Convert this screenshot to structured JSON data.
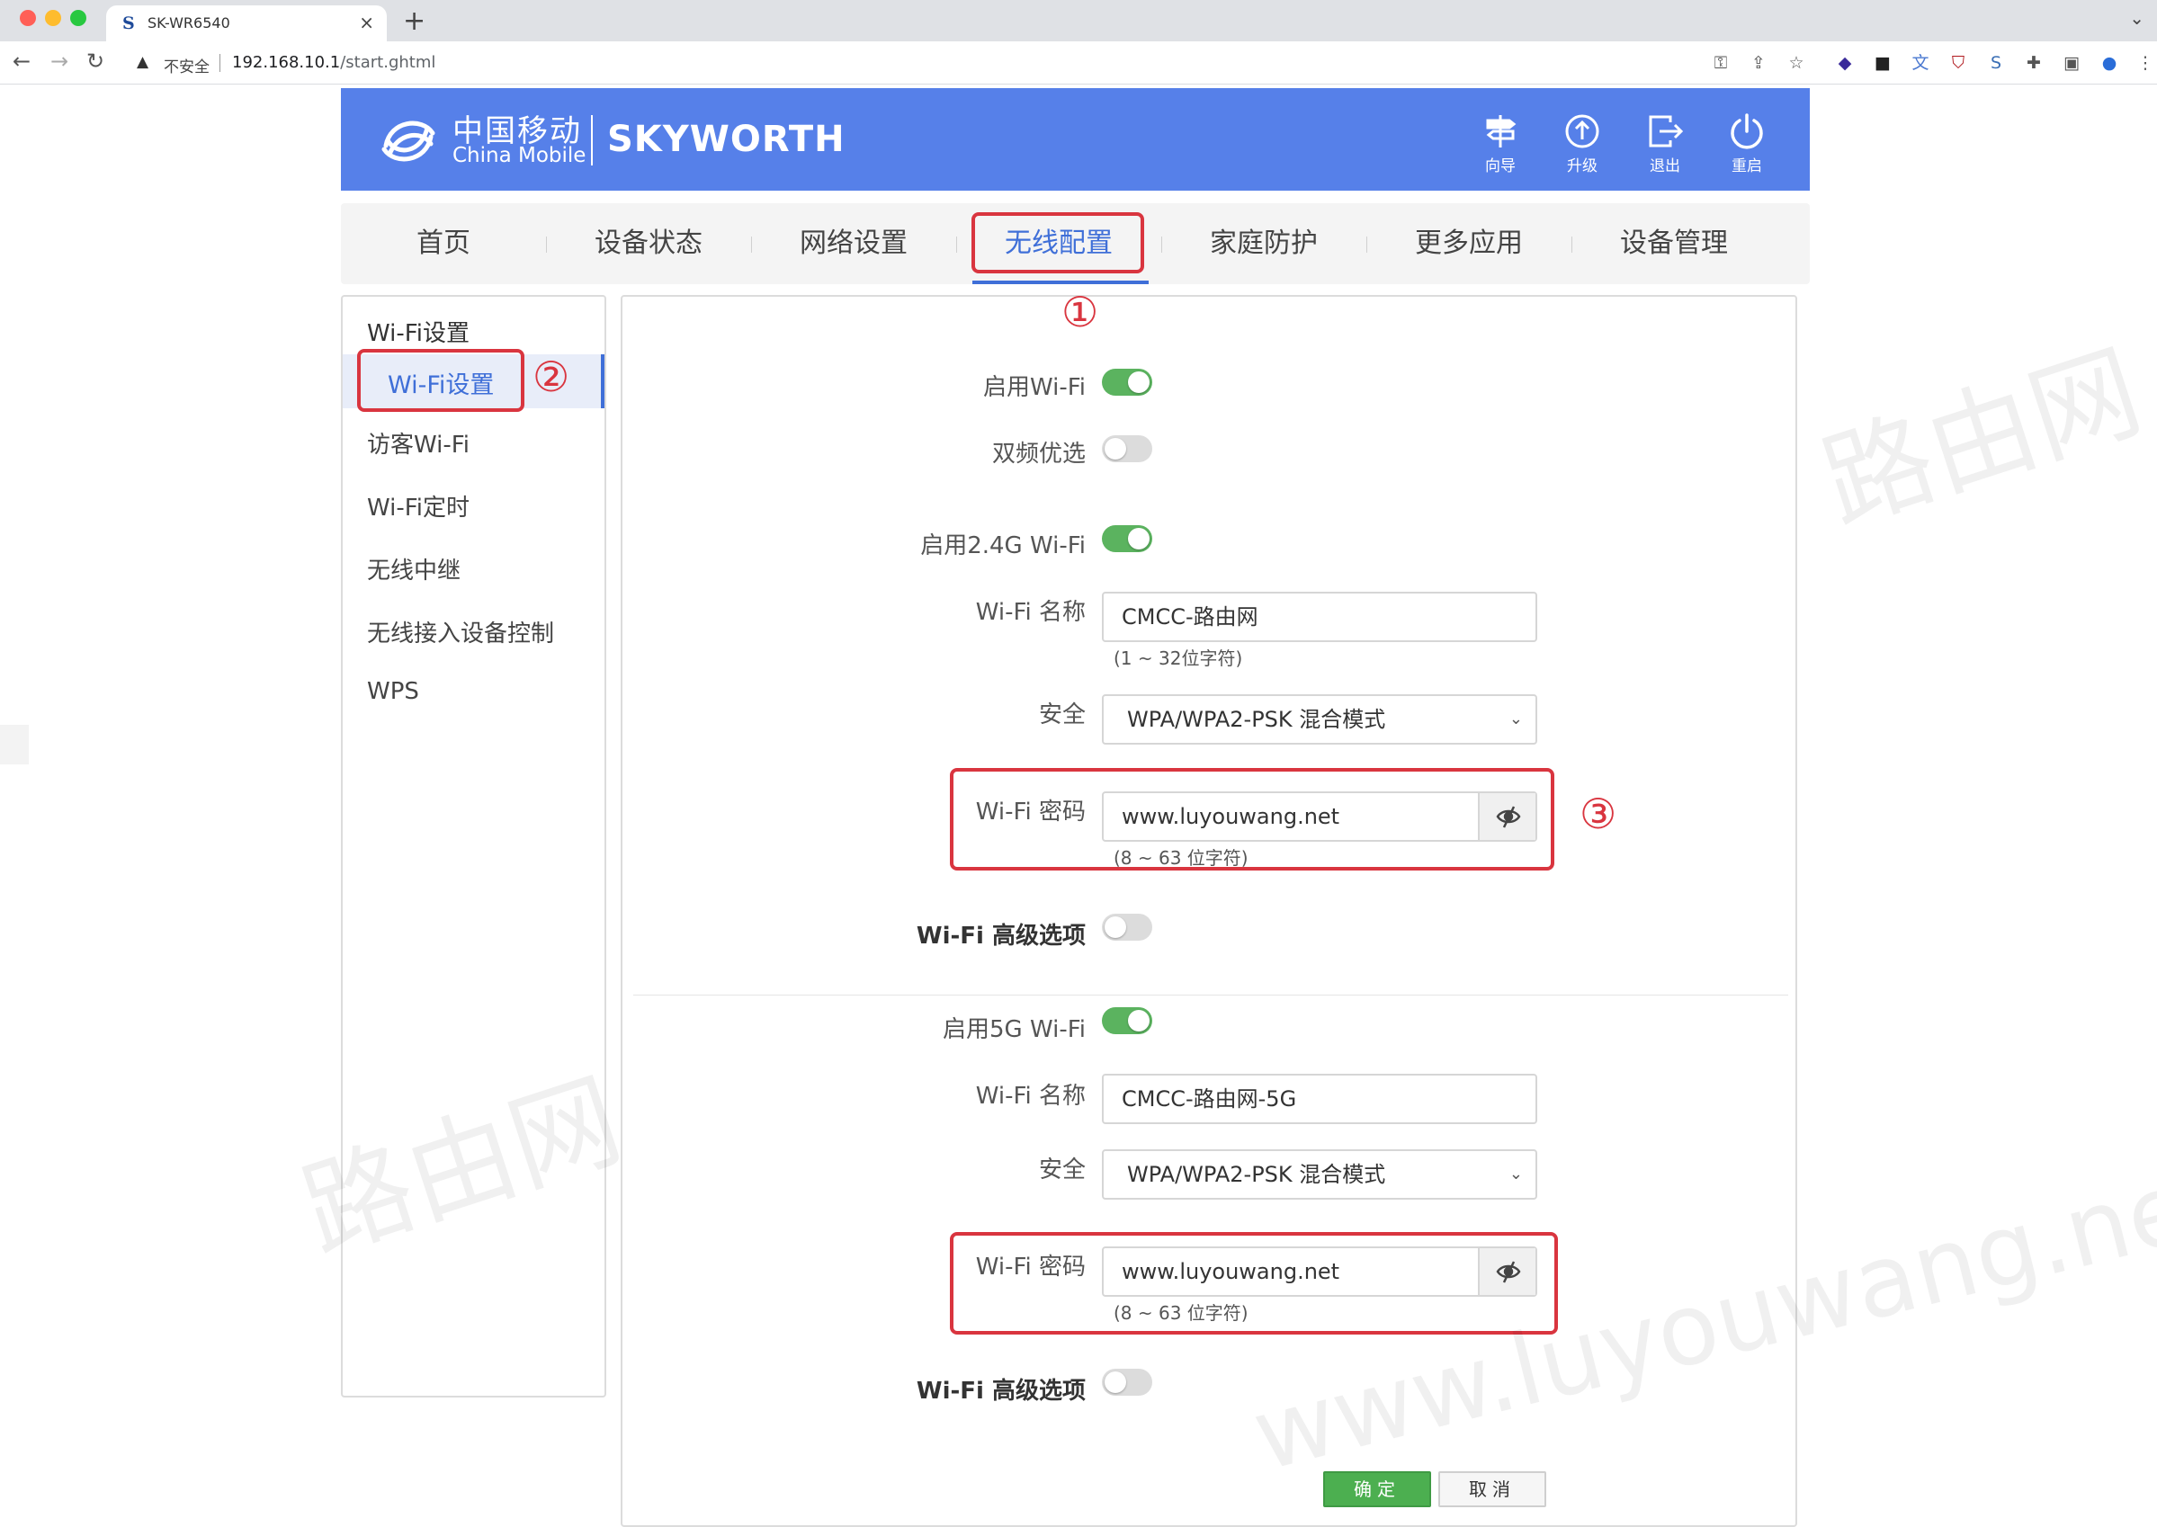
{
  "browser": {
    "tab_title": "SK-WR6540",
    "tab_close": "×",
    "new_tab": "+",
    "insecure_label": "不安全",
    "url_host": "192.168.10.1",
    "url_path": "/start.ghtml"
  },
  "header": {
    "logo_cn": "中国移动",
    "logo_en": "China Mobile",
    "logo_brand": "SKYWORTH",
    "buttons": [
      {
        "label": "向导",
        "icon": "signpost-icon"
      },
      {
        "label": "升级",
        "icon": "upgrade-icon"
      },
      {
        "label": "退出",
        "icon": "logout-icon"
      },
      {
        "label": "重启",
        "icon": "power-icon"
      }
    ]
  },
  "menu": {
    "items": [
      "首页",
      "设备状态",
      "网络设置",
      "无线配置",
      "家庭防护",
      "更多应用",
      "设备管理"
    ],
    "active_index": 3
  },
  "sidebar": {
    "title": "Wi-Fi设置",
    "active": "Wi-Fi设置",
    "items": [
      "访客Wi-Fi",
      "Wi-Fi定时",
      "无线中继",
      "无线接入设备控制",
      "WPS"
    ]
  },
  "annotations": {
    "one": "①",
    "two": "②",
    "three": "③"
  },
  "form": {
    "enable_wifi": {
      "label": "启用Wi-Fi",
      "on": true
    },
    "dual_band": {
      "label": "双频优选",
      "on": false
    },
    "band24": {
      "enable_label": "启用2.4G Wi-Fi",
      "enabled": true,
      "ssid_label": "Wi-Fi 名称",
      "ssid": "CMCC-路由网",
      "ssid_hint": "(1 ~ 32位字符)",
      "security_label": "安全",
      "security": "WPA/WPA2-PSK 混合模式",
      "password_label": "Wi-Fi 密码",
      "password": "www.luyouwang.net",
      "password_hint": "(8 ~ 63 位字符)",
      "advanced_label": "Wi-Fi 高级选项",
      "advanced_on": false
    },
    "band5": {
      "enable_label": "启用5G Wi-Fi",
      "enabled": true,
      "ssid_label": "Wi-Fi 名称",
      "ssid": "CMCC-路由网-5G",
      "security_label": "安全",
      "security": "WPA/WPA2-PSK 混合模式",
      "password_label": "Wi-Fi 密码",
      "password": "www.luyouwang.net",
      "password_hint": "(8 ~ 63 位字符)",
      "advanced_label": "Wi-Fi 高级选项",
      "advanced_on": false
    },
    "ok_label": "确定",
    "cancel_label": "取消"
  },
  "watermark": {
    "cn": "路由网",
    "url": "www.luyouwang.net"
  },
  "colors": {
    "header_blue": "#5680e9",
    "active_blue": "#3f6fd8",
    "annotation_red": "#d9353f",
    "toggle_green": "#5bb35f",
    "ok_green": "#4caf50"
  }
}
